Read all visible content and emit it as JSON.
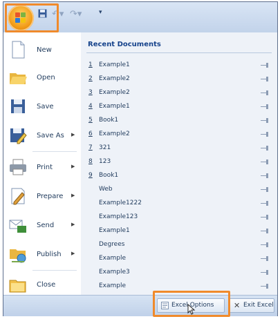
{
  "menu": {
    "items": [
      {
        "label": "New",
        "arrow": ""
      },
      {
        "label": "Open",
        "arrow": ""
      },
      {
        "label": "Save",
        "arrow": ""
      },
      {
        "label": "Save As",
        "arrow": "▶"
      },
      {
        "label": "Print",
        "arrow": "▶"
      },
      {
        "label": "Prepare",
        "arrow": "▶"
      },
      {
        "label": "Send",
        "arrow": "▶"
      },
      {
        "label": "Publish",
        "arrow": "▶"
      },
      {
        "label": "Close",
        "arrow": ""
      }
    ]
  },
  "recent": {
    "title": "Recent Documents",
    "docs": [
      {
        "num": "1",
        "name": "Example1"
      },
      {
        "num": "2",
        "name": "Example2"
      },
      {
        "num": "3",
        "name": "Example2"
      },
      {
        "num": "4",
        "name": "Example1"
      },
      {
        "num": "5",
        "name": "Book1"
      },
      {
        "num": "6",
        "name": "Example2"
      },
      {
        "num": "7",
        "name": "321"
      },
      {
        "num": "8",
        "name": "123"
      },
      {
        "num": "9",
        "name": "Book1"
      },
      {
        "num": "",
        "name": "Web"
      },
      {
        "num": "",
        "name": "Example1222"
      },
      {
        "num": "",
        "name": "Example123"
      },
      {
        "num": "",
        "name": "Example1"
      },
      {
        "num": "",
        "name": "Degrees"
      },
      {
        "num": "",
        "name": "Example"
      },
      {
        "num": "",
        "name": "Example3"
      },
      {
        "num": "",
        "name": "Example"
      }
    ]
  },
  "footer": {
    "options_label": "Excel Options",
    "exit_label": "Exit Excel"
  },
  "colors": {
    "highlight": "#f08a2b",
    "text": "#1e395b",
    "heading": "#15428b"
  }
}
